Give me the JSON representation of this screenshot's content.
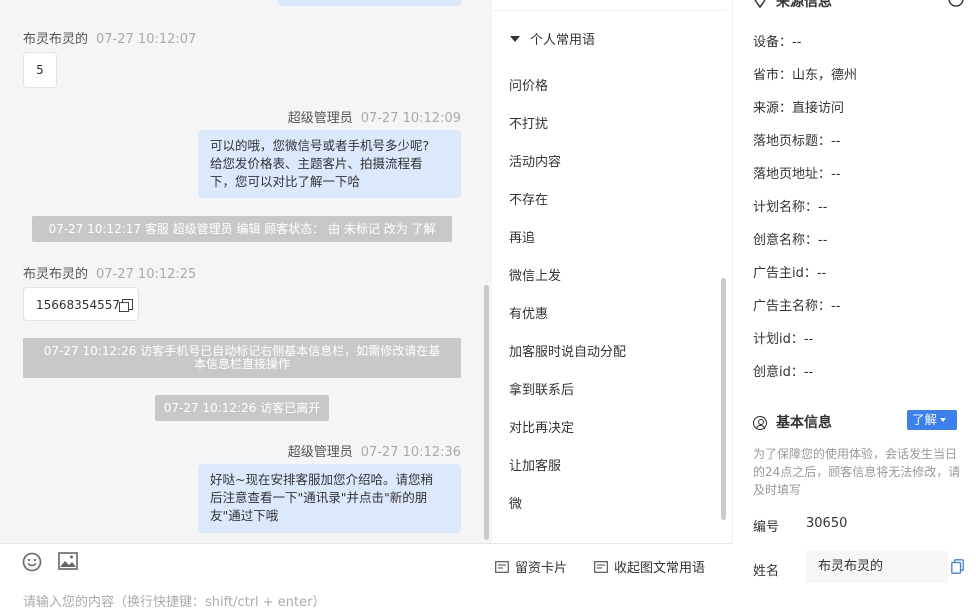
{
  "chat": {
    "messages": [
      {
        "sender": "布灵布灵的",
        "time": "07-27 10:12:07",
        "text": "5"
      },
      {
        "sender": "超级管理员",
        "time": "07-27 10:12:09",
        "lines": [
          "可以的哦，您微信号或者手机号多少呢?",
          "给您发价格表、主题客片、拍摄流程看",
          "下，您可以对比了解一下哈"
        ]
      },
      {
        "system": "07-27 10:12:17 客服 超级管理员 编辑 顾客状态： 由 未标记 改为 了解"
      },
      {
        "sender": "布灵布灵的",
        "time": "07-27 10:12:25",
        "text": "15668354557"
      },
      {
        "system_lines": [
          "07-27 10:12:26 访客手机号已自动标记右侧基本信息栏，如需修改请在基",
          "本信息栏直接操作"
        ]
      },
      {
        "system": "07-27 10:12:26 访客已离开"
      },
      {
        "sender": "超级管理员",
        "time": "07-27 10:12:36",
        "lines": [
          "好哒~现在安排客服加您介绍哈。请您稍",
          "后注意查看一下\"通讯录\"并点击\"新的朋",
          "友\"通过下哦"
        ]
      }
    ]
  },
  "input": {
    "placeholder": "请输入您的内容（换行快捷键：shift/ctrl + enter）",
    "card_button": "留资卡片",
    "collect_button": "收起图文常用语",
    "icons": [
      "emoji-icon",
      "image-icon",
      "card-icon",
      "collect-icon"
    ]
  },
  "phrases": {
    "group_title": "个人常用语",
    "items": [
      "问价格",
      "不打扰",
      "活动内容",
      "不存在",
      "再追",
      "微信上发",
      "有优惠",
      "加客服时说自动分配",
      "拿到联系后",
      "对比再决定",
      "让加客服",
      "微"
    ]
  },
  "info": {
    "source_title": "来源信息",
    "source_rows": [
      "设备：--",
      "省市：山东，德州",
      "来源：直接访问",
      "落地页标题：--",
      "落地页地址：--",
      "计划名称：--",
      "创意名称：--",
      "广告主id：--",
      "广告主名称：--",
      "计划id：--",
      "创意id：--"
    ],
    "basic_title": "基本信息",
    "status_badge": "了解",
    "note": "为了保障您的使用体验，会话发生当日的24点之后，顾客信息将无法修改，请及时填写",
    "id_label": "编号",
    "id_value": "30650",
    "name_label": "姓名",
    "name_value": "布灵布灵的"
  },
  "colors": {
    "accent": "#3b7ff0",
    "bubble_agent": "#dce8fc",
    "system_notice": "#c8c8c8",
    "chat_bg": "#f4f5f7"
  }
}
